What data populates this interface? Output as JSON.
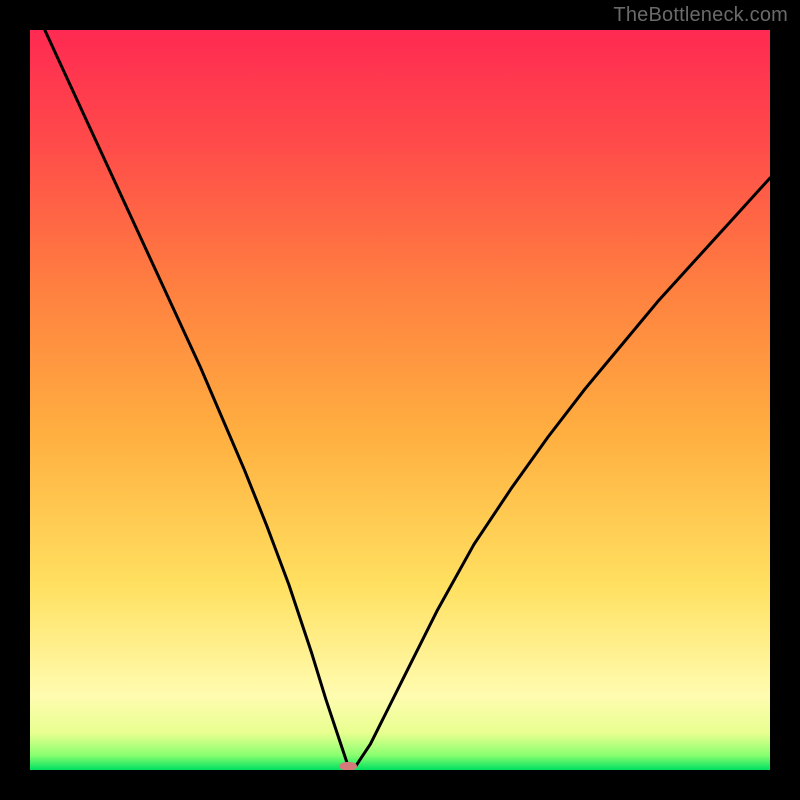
{
  "watermark": "TheBottleneck.com",
  "chart_data": {
    "type": "line",
    "title": "",
    "xlabel": "",
    "ylabel": "",
    "xlim": [
      0,
      1
    ],
    "ylim": [
      0,
      1
    ],
    "background": "rainbow-gradient",
    "gradient_stops": [
      {
        "offset": 0,
        "color": "#00e060"
      },
      {
        "offset": 0.02,
        "color": "#8aff70"
      },
      {
        "offset": 0.05,
        "color": "#e8ff90"
      },
      {
        "offset": 0.1,
        "color": "#fffcb0"
      },
      {
        "offset": 0.25,
        "color": "#ffe060"
      },
      {
        "offset": 0.45,
        "color": "#ffb040"
      },
      {
        "offset": 0.65,
        "color": "#ff8040"
      },
      {
        "offset": 0.85,
        "color": "#ff4a4a"
      },
      {
        "offset": 1.0,
        "color": "#ff2a52"
      }
    ],
    "curve": {
      "stroke": "#000000",
      "stroke_width": 3,
      "description": "V-shaped curve with minimum near x≈0.43 touching y≈0",
      "x": [
        0.02,
        0.05,
        0.08,
        0.11,
        0.14,
        0.17,
        0.2,
        0.23,
        0.26,
        0.29,
        0.32,
        0.35,
        0.38,
        0.4,
        0.42,
        0.43,
        0.44,
        0.46,
        0.48,
        0.51,
        0.55,
        0.6,
        0.65,
        0.7,
        0.75,
        0.8,
        0.85,
        0.9,
        0.95,
        1.0
      ],
      "y": [
        1.0,
        0.935,
        0.87,
        0.805,
        0.74,
        0.675,
        0.61,
        0.545,
        0.475,
        0.405,
        0.33,
        0.25,
        0.16,
        0.095,
        0.035,
        0.005,
        0.005,
        0.035,
        0.075,
        0.135,
        0.215,
        0.305,
        0.38,
        0.45,
        0.515,
        0.575,
        0.635,
        0.69,
        0.745,
        0.8
      ]
    },
    "minimum_marker": {
      "x": 0.43,
      "y": 0.005,
      "rx": 0.012,
      "ry": 0.006,
      "fill": "#d47a7a"
    }
  }
}
